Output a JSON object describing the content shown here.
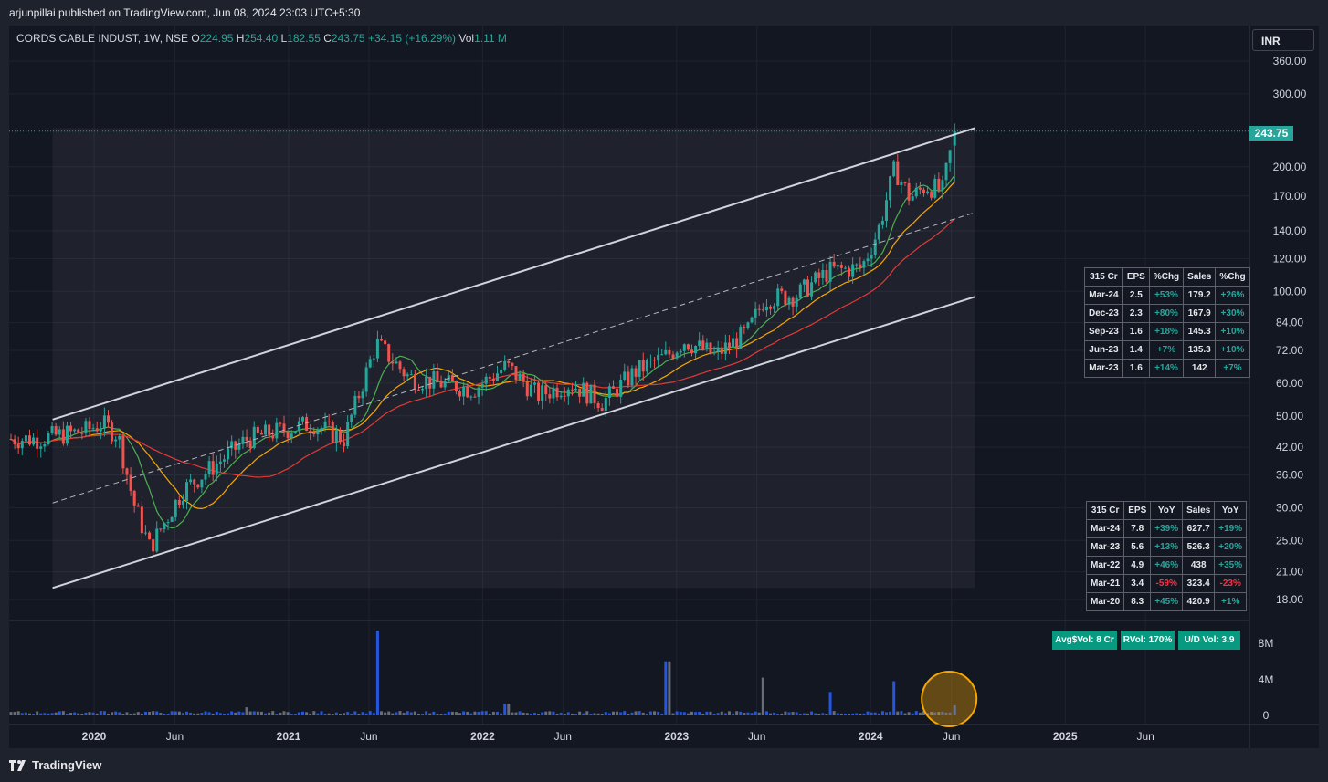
{
  "header": {
    "published": "arjunpillai published on TradingView.com, Jun 08, 2024 23:03 UTC+5:30"
  },
  "legend": {
    "symbol": "CORDS CABLE INDUST, 1W, NSE",
    "o_label": "O",
    "o_value": "224.95",
    "h_label": "H",
    "h_value": "254.40",
    "l_label": "L",
    "l_value": "182.55",
    "c_label": "C",
    "c_value": "243.75",
    "change": "+34.15 (+16.29%)",
    "vol_label": "Vol",
    "vol_value": "1.11 M"
  },
  "currency": "INR",
  "last_price_tag": "243.75",
  "footer": {
    "brand": "TradingView"
  },
  "colors": {
    "up": "#26a69a",
    "down": "#ef5350",
    "vol_up": "#2962ff",
    "badge": "#089981",
    "highlight": "#f7a600"
  },
  "quarterly_table": {
    "headers": [
      "315 Cr",
      "EPS",
      "%Chg",
      "Sales",
      "%Chg"
    ],
    "rows": [
      [
        "Mar-24",
        "2.5",
        "+53%",
        "179.2",
        "+26%"
      ],
      [
        "Dec-23",
        "2.3",
        "+80%",
        "167.9",
        "+30%"
      ],
      [
        "Sep-23",
        "1.6",
        "+18%",
        "145.3",
        "+10%"
      ],
      [
        "Jun-23",
        "1.4",
        "+7%",
        "135.3",
        "+10%"
      ],
      [
        "Mar-23",
        "1.6",
        "+14%",
        "142",
        "+7%"
      ]
    ]
  },
  "annual_table": {
    "headers": [
      "315 Cr",
      "EPS",
      "YoY",
      "Sales",
      "YoY"
    ],
    "rows": [
      [
        "Mar-24",
        "7.8",
        "+39%",
        "627.7",
        "+19%"
      ],
      [
        "Mar-23",
        "5.6",
        "+13%",
        "526.3",
        "+20%"
      ],
      [
        "Mar-22",
        "4.9",
        "+46%",
        "438",
        "+35%"
      ],
      [
        "Mar-21",
        "3.4",
        "-59%",
        "323.4",
        "-23%"
      ],
      [
        "Mar-20",
        "8.3",
        "+45%",
        "420.9",
        "+1%"
      ]
    ]
  },
  "badges": {
    "avg_vol": "Avg$Vol: 8 Cr",
    "rvol": "RVol: 170%",
    "ud_vol": "U/D Vol: 3.9"
  },
  "chart_data": {
    "type": "candlestick",
    "timeframe": "1W",
    "y_scale": "log",
    "ylim": [
      16.5,
      400
    ],
    "y_ticks": [
      "360.00",
      "300.00",
      "200.00",
      "170.00",
      "140.00",
      "120.00",
      "100.00",
      "84.00",
      "72.00",
      "60.00",
      "50.00",
      "42.00",
      "36.00",
      "30.00",
      "25.00",
      "21.00",
      "18.00"
    ],
    "x_ticks": [
      "2020",
      "Jun",
      "2021",
      "Jun",
      "2022",
      "Jun",
      "2023",
      "Jun",
      "2024",
      "Jun",
      "2025",
      "Jun"
    ],
    "volume_ticks": [
      "8M",
      "4M",
      "0"
    ],
    "ohlc_points": [
      {
        "date": "2019-09",
        "close": 44
      },
      {
        "date": "2019-12",
        "close": 46
      },
      {
        "date": "2020-01",
        "close": 48
      },
      {
        "date": "2020-02",
        "close": 45
      },
      {
        "date": "2020-03",
        "close": 31
      },
      {
        "date": "2020-04",
        "close": 24
      },
      {
        "date": "2020-05",
        "close": 28
      },
      {
        "date": "2020-06",
        "close": 33
      },
      {
        "date": "2020-08",
        "close": 38
      },
      {
        "date": "2020-10",
        "close": 44
      },
      {
        "date": "2020-12",
        "close": 46
      },
      {
        "date": "2021-02",
        "close": 48
      },
      {
        "date": "2021-04",
        "close": 44
      },
      {
        "date": "2021-06",
        "close": 75
      },
      {
        "date": "2021-08",
        "close": 62
      },
      {
        "date": "2021-10",
        "close": 60
      },
      {
        "date": "2021-12",
        "close": 58
      },
      {
        "date": "2022-02",
        "close": 66
      },
      {
        "date": "2022-04",
        "close": 56
      },
      {
        "date": "2022-06",
        "close": 60
      },
      {
        "date": "2022-08",
        "close": 54
      },
      {
        "date": "2022-10",
        "close": 64
      },
      {
        "date": "2022-12",
        "close": 70
      },
      {
        "date": "2023-01",
        "close": 76
      },
      {
        "date": "2023-03",
        "close": 70
      },
      {
        "date": "2023-05",
        "close": 80
      },
      {
        "date": "2023-06",
        "close": 96
      },
      {
        "date": "2023-08",
        "close": 98
      },
      {
        "date": "2023-10",
        "close": 112
      },
      {
        "date": "2023-12",
        "close": 114
      },
      {
        "date": "2024-01",
        "close": 140
      },
      {
        "date": "2024-02",
        "close": 198
      },
      {
        "date": "2024-03",
        "close": 168
      },
      {
        "date": "2024-04",
        "close": 180
      },
      {
        "date": "2024-05",
        "close": 175
      },
      {
        "date": "2024-06-07",
        "open": 224.95,
        "high": 254.4,
        "low": 182.55,
        "close": 243.75
      }
    ],
    "volume_points": [
      {
        "date": "2020-01",
        "volume_m": 0.5
      },
      {
        "date": "2020-04",
        "volume_m": 0.4
      },
      {
        "date": "2020-10",
        "volume_m": 0.9
      },
      {
        "date": "2021-06",
        "volume_m": 9.4
      },
      {
        "date": "2022-02",
        "volume_m": 1.3
      },
      {
        "date": "2022-12",
        "volume_m": 6.0
      },
      {
        "date": "2023-06",
        "volume_m": 4.2
      },
      {
        "date": "2023-10",
        "volume_m": 2.6
      },
      {
        "date": "2024-02",
        "volume_m": 3.8
      },
      {
        "date": "2024-06-07",
        "volume_m": 1.11
      }
    ],
    "moving_averages": [
      {
        "color": "#4caf50"
      },
      {
        "color": "#f7a600"
      },
      {
        "color": "#e53935"
      }
    ],
    "channel": {
      "upper": [
        {
          "date": "2019-10",
          "price": 49
        },
        {
          "date": "2024-07",
          "price": 248
        }
      ],
      "lower": [
        {
          "date": "2019-10",
          "price": 19.2
        },
        {
          "date": "2024-07",
          "price": 97
        }
      ],
      "midline": [
        {
          "date": "2019-10",
          "price": 30.8
        },
        {
          "date": "2024-07",
          "price": 155
        }
      ]
    }
  }
}
